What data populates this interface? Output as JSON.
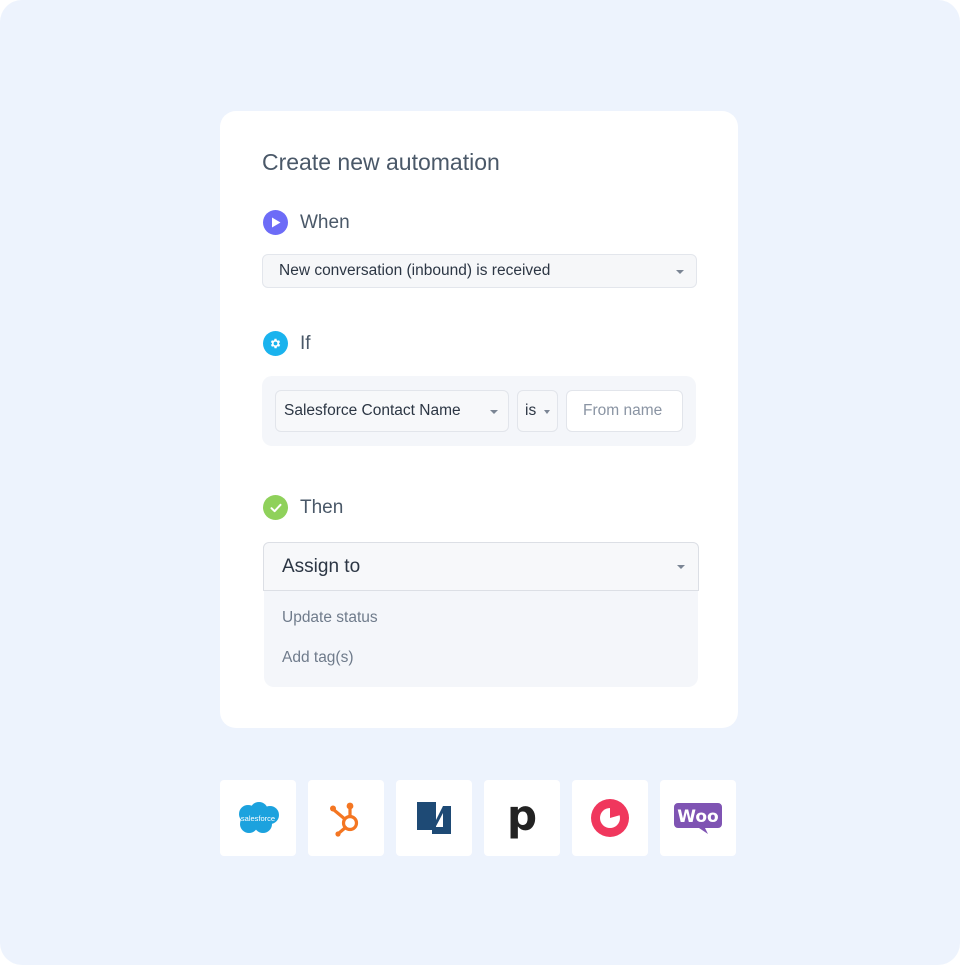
{
  "card": {
    "title": "Create new automation"
  },
  "when": {
    "label": "When",
    "trigger_value": "New conversation (inbound) is received",
    "icon": "play-icon",
    "icon_color": "#6d6cf7"
  },
  "if": {
    "label": "If",
    "field_value": "Salesforce Contact Name",
    "operator_value": "is",
    "value_placeholder": "From name",
    "icon": "gear-icon",
    "icon_color": "#1ab3ee"
  },
  "then": {
    "label": "Then",
    "action_value": "Assign to",
    "options": [
      "Update status",
      "Add tag(s)"
    ],
    "icon": "check-icon",
    "icon_color": "#8fd15b"
  },
  "integrations": [
    {
      "name": "salesforce",
      "text": "salesforce",
      "color": "#1ca2de"
    },
    {
      "name": "hubspot",
      "color": "#f47622"
    },
    {
      "name": "netsuite",
      "text": "N",
      "color": "#1e4a75"
    },
    {
      "name": "pipedrive",
      "text": "p",
      "color": "#222222"
    },
    {
      "name": "copper",
      "color": "#f0375d"
    },
    {
      "name": "woocommerce",
      "text": "Woo",
      "color": "#7f54b3"
    }
  ]
}
